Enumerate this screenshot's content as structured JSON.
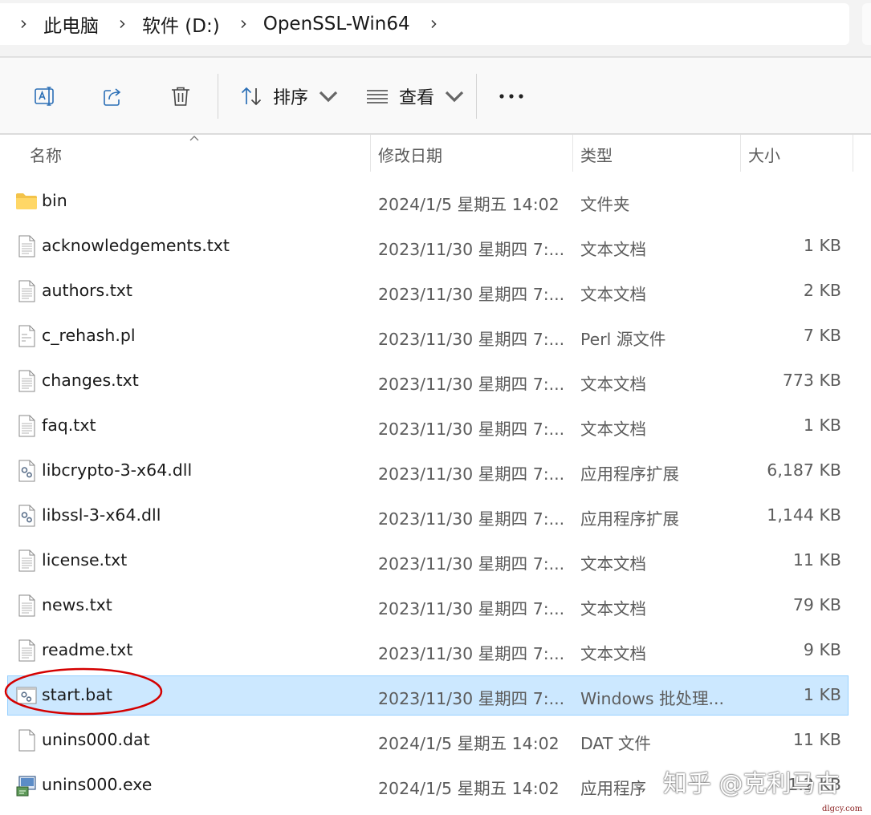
{
  "address_bar": {
    "crumbs": [
      "此电脑",
      "软件 (D:)",
      "OpenSSL-Win64"
    ]
  },
  "toolbar": {
    "sort_label": "排序",
    "view_label": "查看"
  },
  "columns": {
    "name": "名称",
    "date": "修改日期",
    "type": "类型",
    "size": "大小"
  },
  "files": [
    {
      "name": "bin",
      "date": "2024/1/5 星期五 14:02",
      "type": "文件夹",
      "size": "",
      "icon": "folder-icon"
    },
    {
      "name": "acknowledgements.txt",
      "date": "2023/11/30 星期四 7:...",
      "type": "文本文档",
      "size": "1 KB",
      "icon": "text-file-icon"
    },
    {
      "name": "authors.txt",
      "date": "2023/11/30 星期四 7:...",
      "type": "文本文档",
      "size": "2 KB",
      "icon": "text-file-icon"
    },
    {
      "name": "c_rehash.pl",
      "date": "2023/11/30 星期四 7:...",
      "type": "Perl 源文件",
      "size": "7 KB",
      "icon": "perl-file-icon"
    },
    {
      "name": "changes.txt",
      "date": "2023/11/30 星期四 7:...",
      "type": "文本文档",
      "size": "773 KB",
      "icon": "text-file-icon"
    },
    {
      "name": "faq.txt",
      "date": "2023/11/30 星期四 7:...",
      "type": "文本文档",
      "size": "1 KB",
      "icon": "text-file-icon"
    },
    {
      "name": "libcrypto-3-x64.dll",
      "date": "2023/11/30 星期四 7:...",
      "type": "应用程序扩展",
      "size": "6,187 KB",
      "icon": "dll-file-icon"
    },
    {
      "name": "libssl-3-x64.dll",
      "date": "2023/11/30 星期四 7:...",
      "type": "应用程序扩展",
      "size": "1,144 KB",
      "icon": "dll-file-icon"
    },
    {
      "name": "license.txt",
      "date": "2023/11/30 星期四 7:...",
      "type": "文本文档",
      "size": "11 KB",
      "icon": "text-file-icon"
    },
    {
      "name": "news.txt",
      "date": "2023/11/30 星期四 7:...",
      "type": "文本文档",
      "size": "79 KB",
      "icon": "text-file-icon"
    },
    {
      "name": "readme.txt",
      "date": "2023/11/30 星期四 7:...",
      "type": "文本文档",
      "size": "9 KB",
      "icon": "text-file-icon"
    },
    {
      "name": "start.bat",
      "date": "2023/11/30 星期四 7:...",
      "type": "Windows 批处理...",
      "size": "1 KB",
      "icon": "batch-file-icon",
      "selected": true
    },
    {
      "name": "unins000.dat",
      "date": "2024/1/5 星期五 14:02",
      "type": "DAT 文件",
      "size": "11 KB",
      "icon": "blank-file-icon"
    },
    {
      "name": "unins000.exe",
      "date": "2024/1/5 星期五 14:02",
      "type": "应用程序",
      "size": "1.2 KB",
      "icon": "installer-exe-icon"
    }
  ],
  "watermark": "知乎 @克利马古",
  "watermark_small": "dlgcy.com",
  "colors": {
    "selection": "#cce8ff",
    "selection_border": "#99d1ff",
    "annotation": "#d40000",
    "folder": "#f3c34a"
  }
}
